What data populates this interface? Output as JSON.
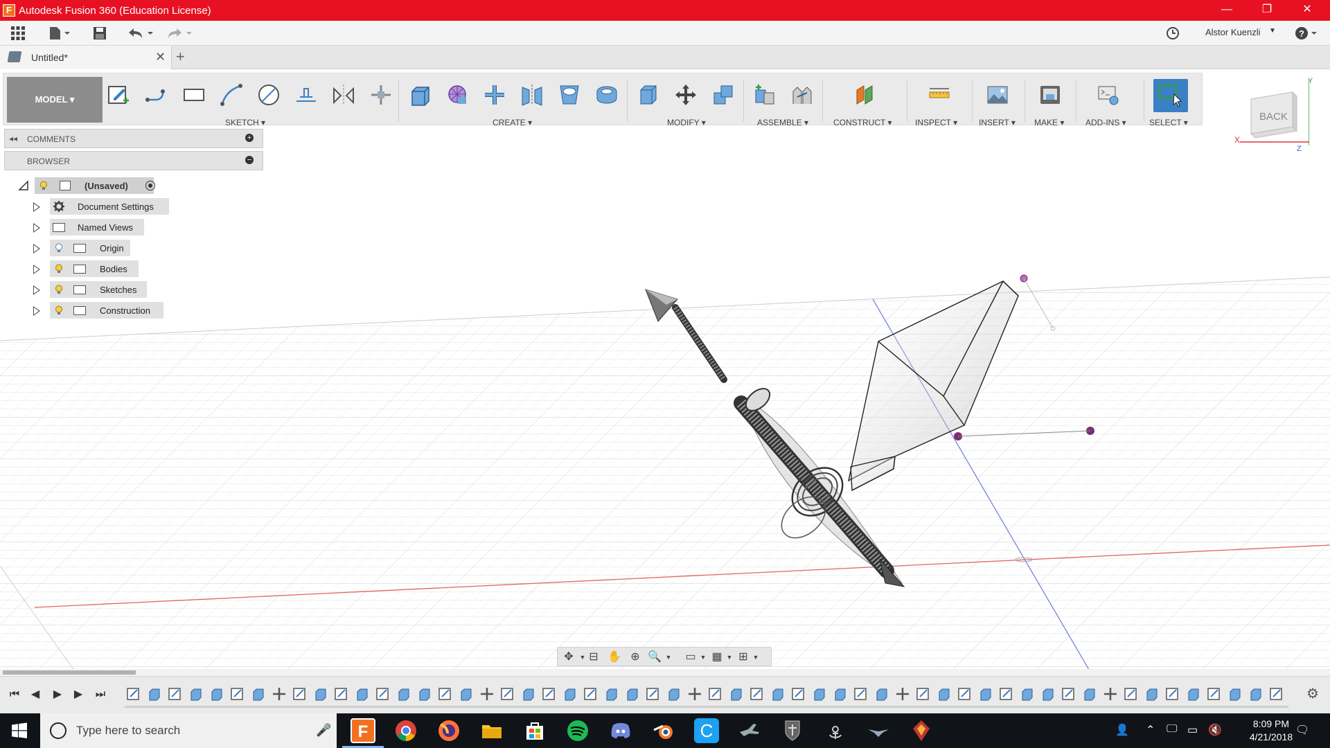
{
  "window": {
    "title": "Autodesk Fusion 360 (Education License)",
    "app_icon_letter": "F",
    "controls": {
      "minimize": "—",
      "maximize": "❐",
      "close": "✕"
    }
  },
  "qat": {
    "user": "Alstor Kuenzli"
  },
  "tabs": {
    "document_tab": "Untitled*",
    "close_glyph": "✕",
    "new_tab_glyph": "+"
  },
  "toolbar": {
    "workspace": "MODEL",
    "groups": [
      {
        "label": "SKETCH"
      },
      {
        "label": "CREATE"
      },
      {
        "label": "MODIFY"
      },
      {
        "label": "ASSEMBLE"
      },
      {
        "label": "CONSTRUCT"
      },
      {
        "label": "INSPECT"
      },
      {
        "label": "INSERT"
      },
      {
        "label": "MAKE"
      },
      {
        "label": "ADD-INS"
      },
      {
        "label": "SELECT"
      }
    ],
    "accent_color": "#3b7fc4"
  },
  "viewcube": {
    "face_label": "BACK",
    "axis_x": "X",
    "axis_y": "Y",
    "axis_z": "Z"
  },
  "panels": {
    "comments": "COMMENTS",
    "browser": "BROWSER"
  },
  "browser_tree": {
    "root": "(Unsaved)",
    "items": [
      {
        "label": "Document Settings",
        "icon": "gear-icon"
      },
      {
        "label": "Named Views",
        "icon": "folder-icon"
      },
      {
        "label": "Origin",
        "icon": "folder-icon",
        "bulb": "off"
      },
      {
        "label": "Bodies",
        "icon": "folder-icon",
        "bulb": "on"
      },
      {
        "label": "Sketches",
        "icon": "folder-icon",
        "bulb": "on"
      },
      {
        "label": "Construction",
        "icon": "folder-icon",
        "bulb": "on"
      }
    ]
  },
  "taskbar": {
    "search_placeholder": "Type here to search",
    "time": "8:09 PM",
    "date": "4/21/2018"
  }
}
